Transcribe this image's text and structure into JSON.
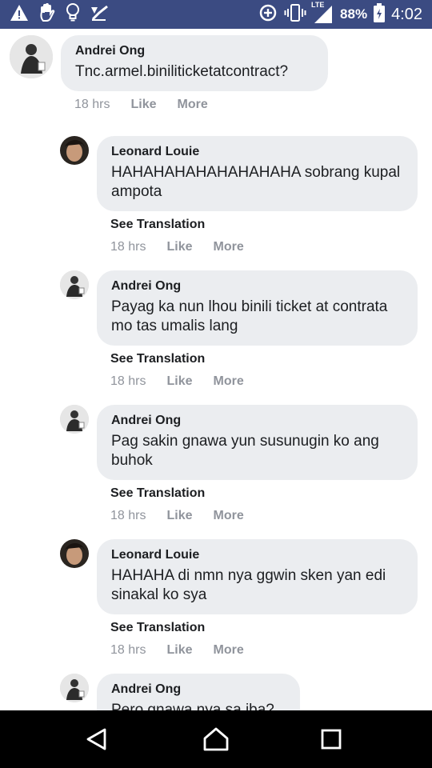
{
  "status_bar": {
    "left_icons": [
      "warning-icon",
      "hand-icon",
      "lightbulb-icon",
      "checkmark-icon"
    ],
    "right_icons": [
      "data-saver-icon",
      "vibrate-icon",
      "lte-signal-icon",
      "battery-icon"
    ],
    "network": "LTE",
    "battery": "88%",
    "time": "4:02"
  },
  "comments": [
    {
      "author": "Andrei Ong",
      "text": "Tnc.armel.biniliticketatcontract?",
      "time": "18 hrs",
      "like": "Like",
      "more": "More"
    },
    {
      "author": "Leonard Louie",
      "text": "HAHAHAHAHAHAHAHAHA sobrang kupal ampota",
      "see_translation": "See Translation",
      "time": "18 hrs",
      "like": "Like",
      "more": "More"
    },
    {
      "author": "Andrei Ong",
      "text": "Payag ka nun lhou binili ticket at contrata mo tas umalis lang",
      "see_translation": "See Translation",
      "time": "18 hrs",
      "like": "Like",
      "more": "More"
    },
    {
      "author": "Andrei Ong",
      "text": "Pag sakin gnawa yun susunugin ko ang buhok",
      "see_translation": "See Translation",
      "time": "18 hrs",
      "like": "Like",
      "more": "More"
    },
    {
      "author": "Leonard Louie",
      "text": "HAHAHA di nmn nya ggwin sken yan edi sinakal ko sya",
      "see_translation": "See Translation",
      "time": "18 hrs",
      "like": "Like",
      "more": "More"
    },
    {
      "author": "Andrei Ong",
      "text": "Pero gnawa nya sa iba?"
    }
  ],
  "nav_bar": {
    "back": "back-icon",
    "home": "home-icon",
    "recents": "recents-icon"
  }
}
